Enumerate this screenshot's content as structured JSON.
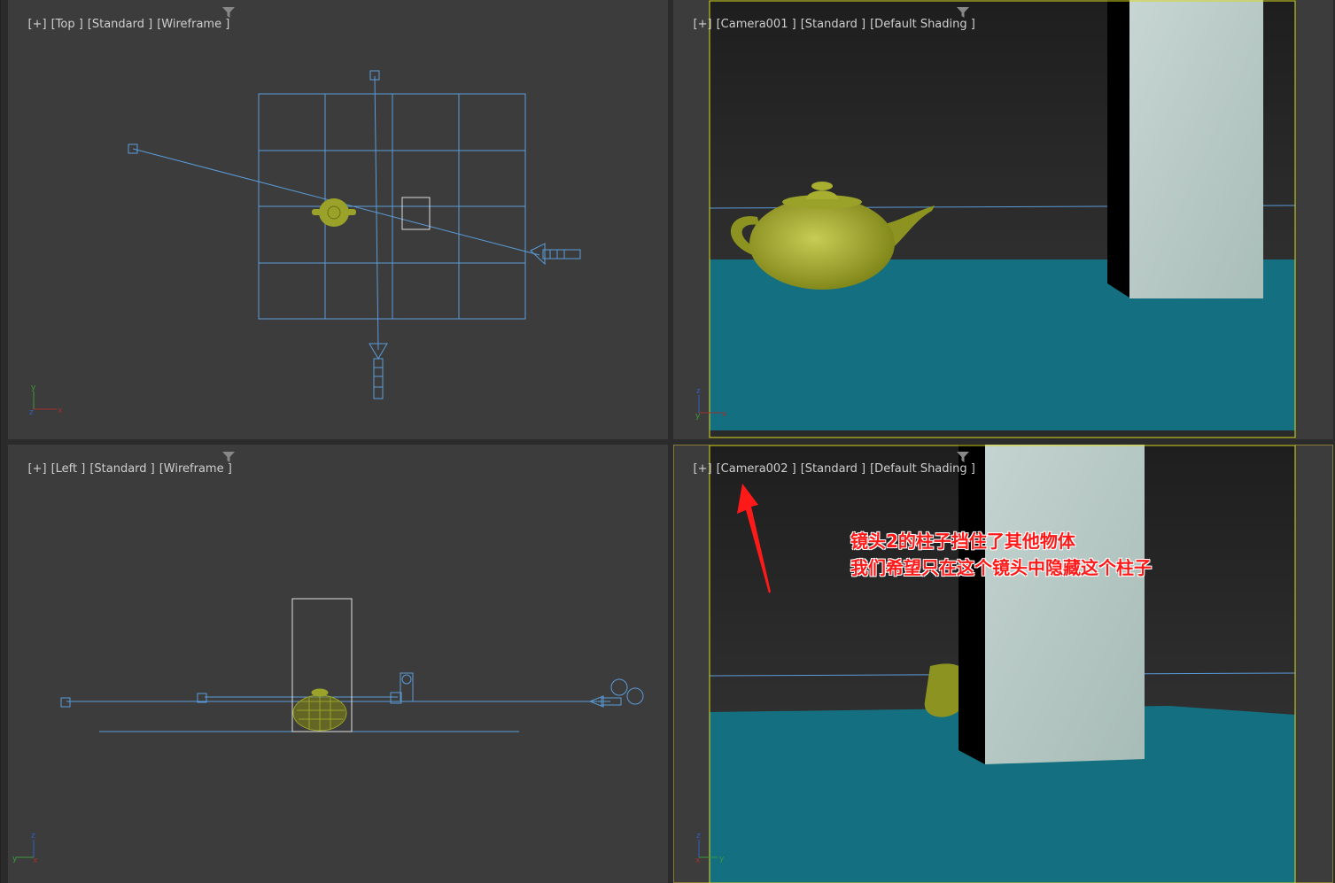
{
  "viewports": {
    "top": {
      "plus": "[+]",
      "view": "[Top ]",
      "preset": "[Standard ]",
      "shading": "[Wireframe ]"
    },
    "cam1": {
      "plus": "[+]",
      "view": "[Camera001 ]",
      "preset": "[Standard ]",
      "shading": "[Default Shading ]"
    },
    "left": {
      "plus": "[+]",
      "view": "[Left ]",
      "preset": "[Standard ]",
      "shading": "[Wireframe ]"
    },
    "cam2": {
      "plus": "[+]",
      "view": "[Camera002 ]",
      "preset": "[Standard ]",
      "shading": "[Default Shading ]"
    }
  },
  "annotation": {
    "line1": "镜头2的柱子挡住了其他物体",
    "line2": "我们希望只在这个镜头中隐藏这个柱子"
  },
  "axes": {
    "x": "x",
    "y": "y",
    "z": "z"
  },
  "colors": {
    "viewport_bg": "#3c3c3c",
    "wire": "#5a9bd8",
    "teapot": "#9aa22a",
    "floor": "#147080",
    "annotation": "#ff1a1a",
    "selection_frame": "#d8d820"
  }
}
